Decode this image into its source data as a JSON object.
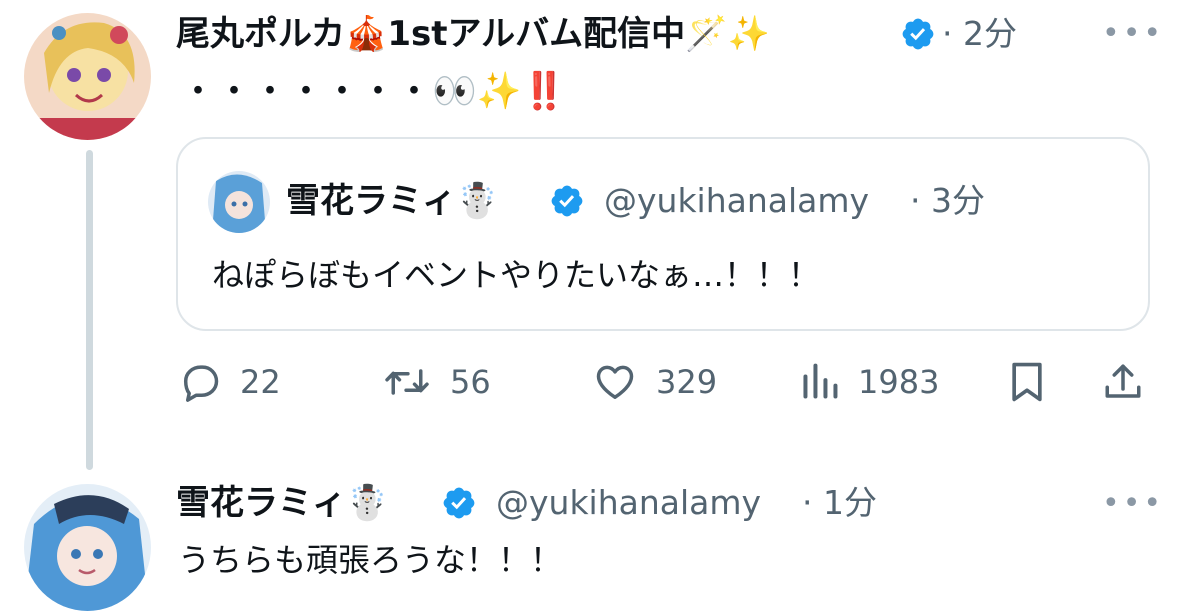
{
  "post": {
    "author_name": "尾丸ポルカ🎪1stアルバム配信中🪄✨",
    "time": "· 2分",
    "text": "・・・・・・・👀✨‼️",
    "more_label": "•••",
    "quoted": {
      "author_name": "雪花ラミィ☃️",
      "handle": "@yukihanalamy",
      "time": "· 3分",
      "text": "ねぽらぼもイベントやりたいなぁ…！！！"
    },
    "actions": {
      "reply_count": "22",
      "repost_count": "56",
      "like_count": "329",
      "view_count": "1983"
    }
  },
  "reply": {
    "author_name": "雪花ラミィ☃️",
    "handle": "@yukihanalamy",
    "time": "· 1分",
    "text": "うちらも頑張ろうな！！！",
    "more_label": "•••"
  },
  "colors": {
    "verified": "#1d9bf0",
    "secondary_text": "#536471",
    "thread_line": "#cfd9de",
    "quote_border": "#dfe5e9"
  }
}
